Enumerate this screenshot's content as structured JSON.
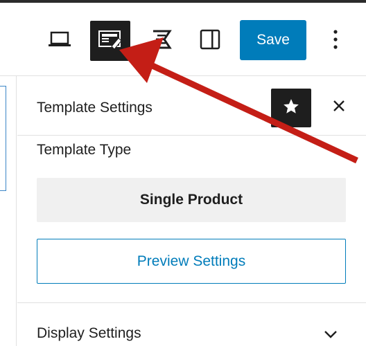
{
  "toolbar": {
    "save_label": "Save",
    "icons": {
      "device": "laptop-icon",
      "template": "template-edit-icon",
      "elementor": "elementor-icon",
      "sidebar": "sidebar-toggle-icon",
      "more": "more-vertical-icon"
    }
  },
  "sidebar": {
    "title": "Template Settings",
    "template_type_label": "Template Type",
    "template_type_value": "Single Product",
    "preview_label": "Preview Settings",
    "display_label": "Display Settings"
  },
  "colors": {
    "accent": "#007cba",
    "dark": "#1e1e1e",
    "annotation_arrow": "#c41e16"
  }
}
